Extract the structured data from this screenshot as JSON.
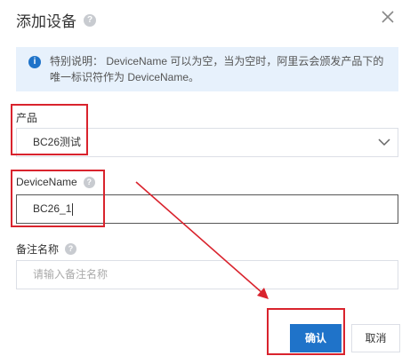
{
  "dialog": {
    "title": "添加设备",
    "help_glyph": "?",
    "close_label": "×"
  },
  "notice": {
    "icon_glyph": "i",
    "line1": "特别说明： DeviceName 可以为空，当为空时，阿里云会颁发产品下的",
    "line2": "唯一标识符作为 DeviceName。"
  },
  "form": {
    "product": {
      "label": "产品",
      "value": "BC26测试"
    },
    "device_name": {
      "label": "DeviceName",
      "value": "BC26_1"
    },
    "remark": {
      "label": "备注名称",
      "placeholder": "请输入备注名称"
    }
  },
  "footer": {
    "confirm_label": "确认",
    "cancel_label": "取消"
  },
  "colors": {
    "primary": "#1f73c9",
    "annotation_red": "#d9232d",
    "notice_bg": "#e7f1fc"
  }
}
